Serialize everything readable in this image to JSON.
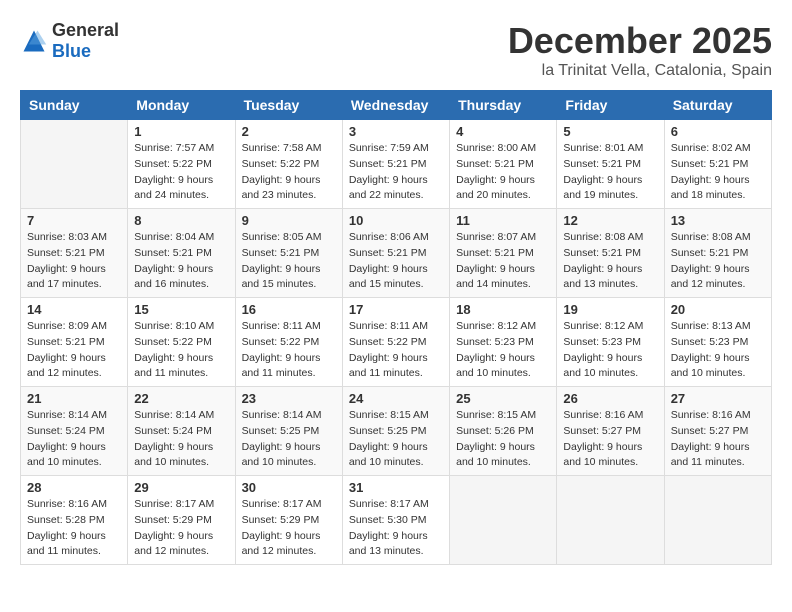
{
  "logo": {
    "general": "General",
    "blue": "Blue"
  },
  "title": "December 2025",
  "location": "la Trinitat Vella, Catalonia, Spain",
  "weekdays": [
    "Sunday",
    "Monday",
    "Tuesday",
    "Wednesday",
    "Thursday",
    "Friday",
    "Saturday"
  ],
  "weeks": [
    [
      {
        "day": "",
        "info": ""
      },
      {
        "day": "1",
        "info": "Sunrise: 7:57 AM\nSunset: 5:22 PM\nDaylight: 9 hours\nand 24 minutes."
      },
      {
        "day": "2",
        "info": "Sunrise: 7:58 AM\nSunset: 5:22 PM\nDaylight: 9 hours\nand 23 minutes."
      },
      {
        "day": "3",
        "info": "Sunrise: 7:59 AM\nSunset: 5:21 PM\nDaylight: 9 hours\nand 22 minutes."
      },
      {
        "day": "4",
        "info": "Sunrise: 8:00 AM\nSunset: 5:21 PM\nDaylight: 9 hours\nand 20 minutes."
      },
      {
        "day": "5",
        "info": "Sunrise: 8:01 AM\nSunset: 5:21 PM\nDaylight: 9 hours\nand 19 minutes."
      },
      {
        "day": "6",
        "info": "Sunrise: 8:02 AM\nSunset: 5:21 PM\nDaylight: 9 hours\nand 18 minutes."
      }
    ],
    [
      {
        "day": "7",
        "info": "Sunrise: 8:03 AM\nSunset: 5:21 PM\nDaylight: 9 hours\nand 17 minutes."
      },
      {
        "day": "8",
        "info": "Sunrise: 8:04 AM\nSunset: 5:21 PM\nDaylight: 9 hours\nand 16 minutes."
      },
      {
        "day": "9",
        "info": "Sunrise: 8:05 AM\nSunset: 5:21 PM\nDaylight: 9 hours\nand 15 minutes."
      },
      {
        "day": "10",
        "info": "Sunrise: 8:06 AM\nSunset: 5:21 PM\nDaylight: 9 hours\nand 15 minutes."
      },
      {
        "day": "11",
        "info": "Sunrise: 8:07 AM\nSunset: 5:21 PM\nDaylight: 9 hours\nand 14 minutes."
      },
      {
        "day": "12",
        "info": "Sunrise: 8:08 AM\nSunset: 5:21 PM\nDaylight: 9 hours\nand 13 minutes."
      },
      {
        "day": "13",
        "info": "Sunrise: 8:08 AM\nSunset: 5:21 PM\nDaylight: 9 hours\nand 12 minutes."
      }
    ],
    [
      {
        "day": "14",
        "info": "Sunrise: 8:09 AM\nSunset: 5:21 PM\nDaylight: 9 hours\nand 12 minutes."
      },
      {
        "day": "15",
        "info": "Sunrise: 8:10 AM\nSunset: 5:22 PM\nDaylight: 9 hours\nand 11 minutes."
      },
      {
        "day": "16",
        "info": "Sunrise: 8:11 AM\nSunset: 5:22 PM\nDaylight: 9 hours\nand 11 minutes."
      },
      {
        "day": "17",
        "info": "Sunrise: 8:11 AM\nSunset: 5:22 PM\nDaylight: 9 hours\nand 11 minutes."
      },
      {
        "day": "18",
        "info": "Sunrise: 8:12 AM\nSunset: 5:23 PM\nDaylight: 9 hours\nand 10 minutes."
      },
      {
        "day": "19",
        "info": "Sunrise: 8:12 AM\nSunset: 5:23 PM\nDaylight: 9 hours\nand 10 minutes."
      },
      {
        "day": "20",
        "info": "Sunrise: 8:13 AM\nSunset: 5:23 PM\nDaylight: 9 hours\nand 10 minutes."
      }
    ],
    [
      {
        "day": "21",
        "info": "Sunrise: 8:14 AM\nSunset: 5:24 PM\nDaylight: 9 hours\nand 10 minutes."
      },
      {
        "day": "22",
        "info": "Sunrise: 8:14 AM\nSunset: 5:24 PM\nDaylight: 9 hours\nand 10 minutes."
      },
      {
        "day": "23",
        "info": "Sunrise: 8:14 AM\nSunset: 5:25 PM\nDaylight: 9 hours\nand 10 minutes."
      },
      {
        "day": "24",
        "info": "Sunrise: 8:15 AM\nSunset: 5:25 PM\nDaylight: 9 hours\nand 10 minutes."
      },
      {
        "day": "25",
        "info": "Sunrise: 8:15 AM\nSunset: 5:26 PM\nDaylight: 9 hours\nand 10 minutes."
      },
      {
        "day": "26",
        "info": "Sunrise: 8:16 AM\nSunset: 5:27 PM\nDaylight: 9 hours\nand 10 minutes."
      },
      {
        "day": "27",
        "info": "Sunrise: 8:16 AM\nSunset: 5:27 PM\nDaylight: 9 hours\nand 11 minutes."
      }
    ],
    [
      {
        "day": "28",
        "info": "Sunrise: 8:16 AM\nSunset: 5:28 PM\nDaylight: 9 hours\nand 11 minutes."
      },
      {
        "day": "29",
        "info": "Sunrise: 8:17 AM\nSunset: 5:29 PM\nDaylight: 9 hours\nand 12 minutes."
      },
      {
        "day": "30",
        "info": "Sunrise: 8:17 AM\nSunset: 5:29 PM\nDaylight: 9 hours\nand 12 minutes."
      },
      {
        "day": "31",
        "info": "Sunrise: 8:17 AM\nSunset: 5:30 PM\nDaylight: 9 hours\nand 13 minutes."
      },
      {
        "day": "",
        "info": ""
      },
      {
        "day": "",
        "info": ""
      },
      {
        "day": "",
        "info": ""
      }
    ]
  ]
}
